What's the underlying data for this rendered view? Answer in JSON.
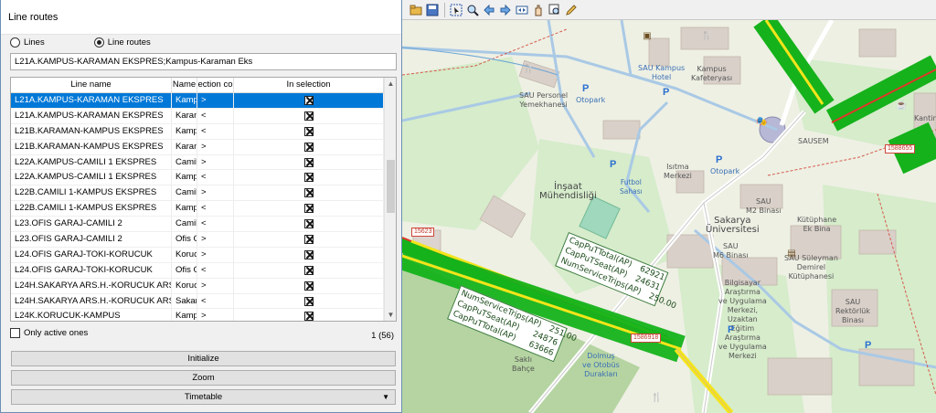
{
  "dialog": {
    "title": "Line routes",
    "radio_lines": "Lines",
    "radio_routes": "Line routes",
    "filter_value": "L21A.KAMPUS-KARAMAN EKSPRES;Kampus-Karaman Eks",
    "columns": [
      "Line name",
      "Name",
      "ection co",
      "In selection"
    ],
    "rows": [
      {
        "line": "L21A.KAMPUS-KARAMAN EKSPRES",
        "name": "Kampu",
        "dir": ">",
        "sel": true,
        "highlight": true
      },
      {
        "line": "L21A.KAMPUS-KARAMAN EKSPRES",
        "name": "Karam",
        "dir": "<",
        "sel": true
      },
      {
        "line": "L21B.KARAMAN-KAMPUS EKSPRES",
        "name": "Kampu",
        "dir": "<",
        "sel": true
      },
      {
        "line": "L21B.KARAMAN-KAMPUS EKSPRES",
        "name": "Karam",
        "dir": ">",
        "sel": true
      },
      {
        "line": "L22A.KAMPUS-CAMILI 1 EKSPRES",
        "name": "Camili",
        "dir": ">",
        "sel": true
      },
      {
        "line": "L22A.KAMPUS-CAMILI 1 EKSPRES",
        "name": "Kampu",
        "dir": "<",
        "sel": true
      },
      {
        "line": "L22B.CAMILI 1-KAMPUS EKSPRES",
        "name": "Camili",
        "dir": ">",
        "sel": true
      },
      {
        "line": "L22B.CAMILI 1-KAMPUS EKSPRES",
        "name": "Kampu",
        "dir": "<",
        "sel": true
      },
      {
        "line": "L23.OFIS GARAJ-CAMILI 2",
        "name": "Camili",
        "dir": "<",
        "sel": true
      },
      {
        "line": "L23.OFIS GARAJ-CAMILI 2",
        "name": "Ofis G",
        "dir": ">",
        "sel": true
      },
      {
        "line": "L24.OFIS GARAJ-TOKI-KORUCUK",
        "name": "Koruc",
        "dir": ">",
        "sel": true
      },
      {
        "line": "L24.OFIS GARAJ-TOKI-KORUCUK",
        "name": "Ofis G",
        "dir": "<",
        "sel": true
      },
      {
        "line": "L24H.SAKARYA ARS.H.-KORUCUK ARS.",
        "name": "Koruc",
        "dir": ">",
        "sel": true
      },
      {
        "line": "L24H.SAKARYA ARS.H.-KORUCUK ARS.",
        "name": "Sakar",
        "dir": "<",
        "sel": true
      },
      {
        "line": "L24K.KORUCUK-KAMPUS",
        "name": "Kampu",
        "dir": ">",
        "sel": true
      }
    ],
    "only_active_label": "Only active ones",
    "count": "1 (56)",
    "btn_initialize": "Initialize",
    "btn_zoom": "Zoom",
    "btn_timetable": "Timetable"
  },
  "toolbar": {
    "icons": [
      "open-icon",
      "save-icon",
      "select-icon",
      "zoom-icon",
      "back-icon",
      "forward-icon",
      "fit-icon",
      "pan-icon",
      "zoom-box-icon",
      "edit-icon"
    ]
  },
  "map": {
    "labels": {
      "personel": "SAU Personel\nYemekhanesi",
      "otopark1": "Otopark",
      "kampus_hotel": "SAU Kampus\nHotel",
      "kampus_kafe": "Kampus\nKafeteryası",
      "kantin": "Kantin",
      "sausem": "SAUSEM",
      "insaat": "İnşaat\nMühendisliği",
      "futbol": "Futbol\nSahası",
      "isitma": "Isıtma\nMerkezi",
      "otopark2": "Otopark",
      "m2": "SAU\nM2 Binası",
      "sakarya_uni": "Sakarya\nÜniversitesi",
      "m6": "SAU\nM6 Binası",
      "kutuphane": "Kütüphane\nEk Bina",
      "suleyman": "SAU Süleyman\nDemirel\nKütüphanesi",
      "bilgisayar": "Bilgisayar\nAraştırma\nve Uygulama\nMerkezi,\nUzaktan\nEğitim\nAraştırma\nve Uygulama\nMerkezi",
      "rektorluk": "SAU\nRektörlük\nBinası",
      "sakli": "Saklı\nBahçe",
      "dolmus": "Dolmuş\nve Otobüs\nDurakları"
    },
    "badges": {
      "b1": "15623",
      "b2": "1586918",
      "b3": "1588655"
    },
    "link_upper": [
      {
        "k": "CapPuTTotal(AP)",
        "v": "62921"
      },
      {
        "k": "CapPuTSeat(AP)",
        "v": "24631"
      },
      {
        "k": "NumServiceTrips(AP)",
        "v": "250.00"
      }
    ],
    "link_lower": [
      {
        "k": "NumServiceTrips(AP)",
        "v": "251.00"
      },
      {
        "k": "CapPuTSeat(AP)",
        "v": "24876"
      },
      {
        "k": "CapPuTTotal(AP)",
        "v": "63666"
      }
    ],
    "colors": {
      "link_green": "#15b21b",
      "link_yellow": "#f4e51a",
      "link_red": "#e1372a",
      "park": "#d6eccb",
      "building": "#d9d0c9",
      "road_blue": "#a9c9e5"
    }
  }
}
